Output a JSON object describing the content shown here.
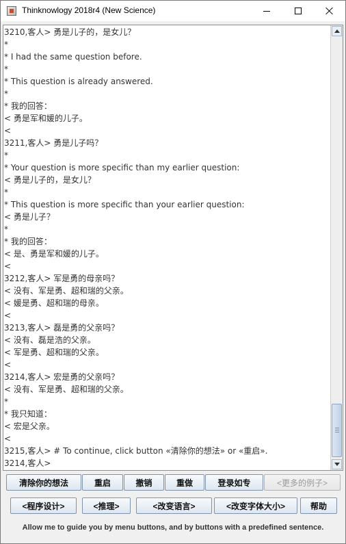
{
  "window": {
    "title": "Thinknowlogy 2018r4 (New Science)"
  },
  "conversation": {
    "lines": [
      "3210,客人> 勇是儿子的，是女儿？",
      "*",
      "* I had the same question before.",
      "*",
      "* This question is already answered.",
      "*",
      "* 我的回答：",
      "< 勇是军和媛的儿子。",
      "<",
      "3211,客人> 勇是儿子吗？",
      "*",
      "* Your question is more specific than my earlier question:",
      "< 勇是儿子的，是女儿？",
      "*",
      "* This question is more specific than your earlier question:",
      "< 勇是儿子？",
      "*",
      "* 我的回答：",
      "< 是、勇是军和媛的儿子。",
      "<",
      "3212,客人> 军是勇的母亲吗？",
      "< 没有、军是勇、超和瑞的父亲。",
      "< 媛是勇、超和瑞的母亲。",
      "<",
      "3213,客人> 磊是勇的父亲吗？",
      "< 没有、磊是浩的父亲。",
      "< 军是勇、超和瑞的父亲。",
      "<",
      "3214,客人> 宏是勇的父亲吗？",
      "< 没有、军是勇、超和瑞的父亲。",
      "*",
      "* 我只知道：",
      "< 宏是父亲。",
      "<",
      "3215,客人> # To continue, click button «清除你的想法» or «重启».",
      "3214,客人>"
    ]
  },
  "buttons_row1": {
    "clear": "清除你的想法",
    "restart": "重启",
    "undo": "撤销",
    "redo": "重做",
    "login": "登录如专",
    "more_examples": "<更多的例子>"
  },
  "buttons_row2": {
    "programming": "<程序设计>",
    "reasoning": "<推理>",
    "change_language": "<改变语言>",
    "change_font_size": "<改变字体大小>",
    "help": "帮助"
  },
  "hint": "Allow me to guide you by menu buttons, and by buttons with a predefined sentence."
}
